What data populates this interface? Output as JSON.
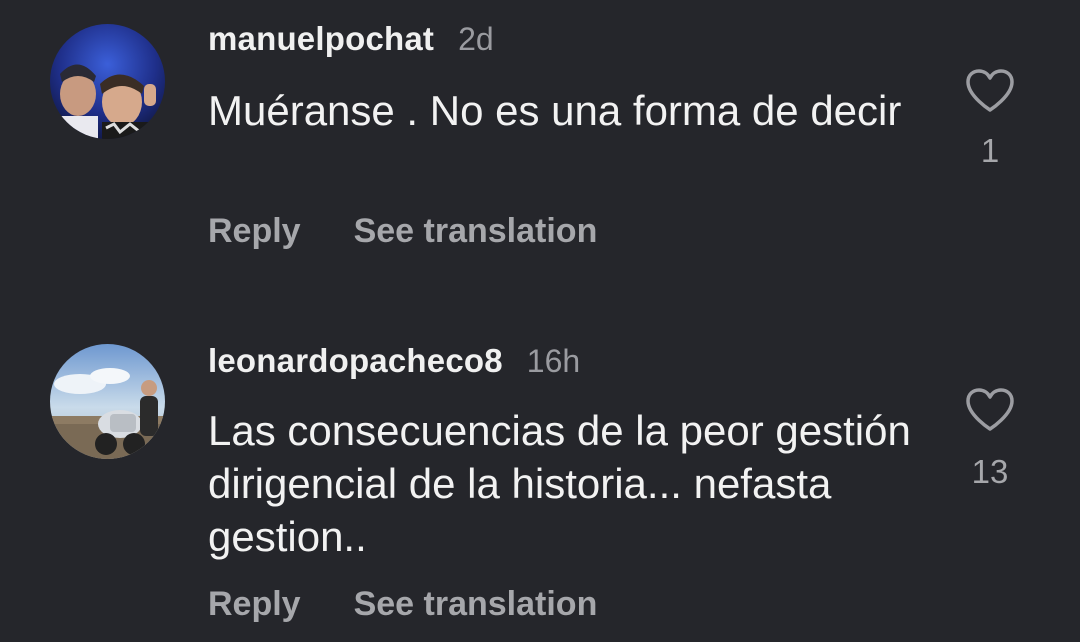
{
  "comments": [
    {
      "username": "manuelpochat",
      "timestamp": "2d",
      "text": "Muéranse . No es una forma de decir",
      "like_count": "1",
      "reply_label": "Reply",
      "translation_label": "See translation",
      "like_icon": "heart-outline-icon"
    },
    {
      "username": "leonardopacheco8",
      "timestamp": "16h",
      "text": "Las consecuencias de la peor gestión dirigencial de la historia... nefasta gestion..",
      "like_count": "13",
      "reply_label": "Reply",
      "translation_label": "See translation",
      "like_icon": "heart-outline-icon"
    }
  ],
  "colors": {
    "background": "#25262b",
    "primary_text": "#f2f2f2",
    "secondary_text": "#a6a7ab"
  }
}
